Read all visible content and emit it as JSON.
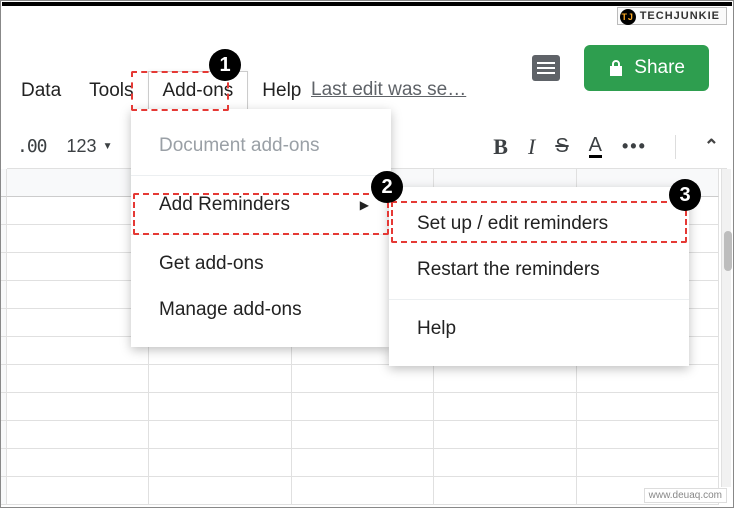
{
  "brand": {
    "label": "TECHJUNKIE",
    "badge": "TJ"
  },
  "menubar": {
    "data": "Data",
    "tools": "Tools",
    "addons": "Add-ons",
    "help": "Help"
  },
  "last_edit": "Last edit was se…",
  "share": {
    "label": "Share"
  },
  "toolbar": {
    "decimal": ".00",
    "format123": "123",
    "bold": "B",
    "italic": "I",
    "strike": "S",
    "color": "A",
    "more": "•••",
    "collapse": "⌃"
  },
  "dropdown1": {
    "document_addons": "Document add-ons",
    "add_reminders": "Add Reminders",
    "get_addons": "Get add-ons",
    "manage_addons": "Manage add-ons"
  },
  "dropdown2": {
    "setup": "Set up / edit reminders",
    "restart": "Restart the reminders",
    "help": "Help"
  },
  "badges": {
    "one": "1",
    "two": "2",
    "three": "3"
  },
  "watermark": "www.deuaq.com"
}
